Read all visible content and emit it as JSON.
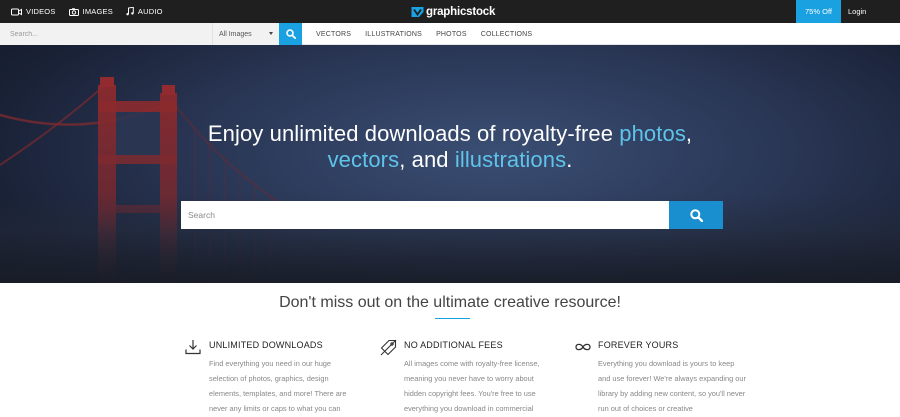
{
  "topbar": {
    "media_links": [
      {
        "label": "VIDEOS",
        "icon": "video-camera-icon"
      },
      {
        "label": "IMAGES",
        "icon": "camera-icon"
      },
      {
        "label": "AUDIO",
        "icon": "music-note-icon"
      }
    ],
    "logo_text": "graphicstock",
    "promo_label": "75% Off",
    "login_label": "Login"
  },
  "searchbar": {
    "placeholder": "Search...",
    "type_selected": "All Images",
    "nav": [
      "VECTORS",
      "ILLUSTRATIONS",
      "PHOTOS",
      "COLLECTIONS"
    ]
  },
  "hero": {
    "title_part1": "Enjoy unlimited downloads of royalty-free ",
    "title_hl1": "photos",
    "title_part2": ",",
    "title_hl2": "vectors",
    "title_part3": ", and ",
    "title_hl3": "illustrations",
    "title_part4": ".",
    "search_placeholder": "Search"
  },
  "content": {
    "tagline": "Don't miss out on the ultimate creative resource!",
    "features": [
      {
        "title": "UNLIMITED DOWNLOADS",
        "icon": "download-icon",
        "text": "Find everything you need in our huge selection of photos, graphics, design elements, templates, and more! There are never any limits or caps to what you can"
      },
      {
        "title": "NO ADDITIONAL FEES",
        "icon": "no-fee-tag-icon",
        "text": "All images come with royalty-free license, meaning you never have to worry about hidden copyright fees. You're free to use everything you download in commercial"
      },
      {
        "title": "FOREVER YOURS",
        "icon": "infinity-icon",
        "text": "Everything you download is yours to keep and use forever! We're always expanding our library by adding new content, so you'll never run out of choices or creative"
      }
    ]
  },
  "colors": {
    "accent": "#1aa1e1",
    "topbar_bg": "#1f1f1f",
    "highlight_text": "#5fc3ea"
  }
}
